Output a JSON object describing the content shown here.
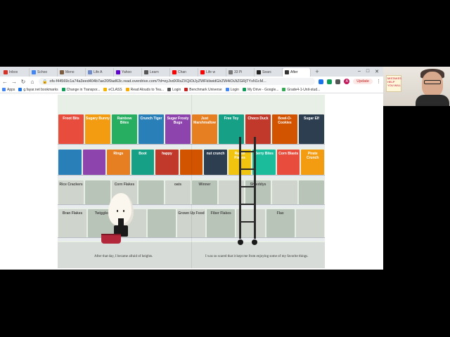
{
  "browser": {
    "tabs": [
      {
        "label": "Inbox",
        "color": "#d93025"
      },
      {
        "label": "Schoo",
        "color": "#4285f4"
      },
      {
        "label": "Meno",
        "color": "#7b5c3e"
      },
      {
        "label": "Life A",
        "color": "#6f8cc8"
      },
      {
        "label": "Yahoo",
        "color": "#6001d2"
      },
      {
        "label": "Learn",
        "color": "#555555"
      },
      {
        "label": "Chan",
        "color": "#ff0000"
      },
      {
        "label": "Life w",
        "color": "#ff0000"
      },
      {
        "label": "33 Pi",
        "color": "#777777"
      },
      {
        "label": "Searc",
        "color": "#222222"
      },
      {
        "label": "After",
        "color": "#333333",
        "active": true
      }
    ],
    "newtab": "+",
    "url": "ofs-f44569c1a74a3eed404b7ae20f9ad63c.read.overdrive.com/?d=eyJvdXRsZXQiOiJyZWFkIiwidGlrZW4iOiJtZGRjTYxN1cM...",
    "update_label": "Update",
    "profile_initial": "A",
    "bookmarks": [
      {
        "label": "Apps",
        "color": "#4285f4"
      },
      {
        "label": "g.fayar.net bookmarks",
        "color": "#1a73e8"
      },
      {
        "label": "Change in Transpor...",
        "color": "#0f9d58"
      },
      {
        "label": "eCLASS",
        "color": "#f4b400"
      },
      {
        "label": "Read Alouds to Tea...",
        "color": "#f9ab00"
      },
      {
        "label": "Login",
        "color": "#555555"
      },
      {
        "label": "Benchmark Universe",
        "color": "#c5221f"
      },
      {
        "label": "Login",
        "color": "#4285f4"
      },
      {
        "label": "My Drive - Google...",
        "color": "#0f9d58"
      },
      {
        "label": "Grade4-1-Unit-stud...",
        "color": "#34a853"
      }
    ]
  },
  "book": {
    "caption_left": "After that day, I became afraid of heights.",
    "caption_right": "I was so scared that it kept me from enjoying some of my favorite things.",
    "boxes_row1": [
      "Froot Bits",
      "Sugary Bunny",
      "Rainbow Bites",
      "Crunch Tiger",
      "Sugar Frosty Bugs",
      "Just Marshmallow",
      "Free Toy",
      "Choco Duck",
      "Bowl-O-Cookies",
      "Sugar Elf"
    ],
    "boxes_row2": [
      "",
      "",
      "Rings",
      "Boot",
      "happy",
      "",
      "nut crunch",
      "Raisin Flakes",
      "Berry Bites",
      "Corn Blasts",
      "Pirate Crunch"
    ],
    "boxes_row3": [
      "Rice Crackers",
      "",
      "Corn Flakes",
      "",
      "oats",
      "Winner",
      "",
      "Shreddys",
      "",
      ""
    ],
    "boxes_row4": [
      "Bran Flakes",
      "Twiggles",
      "",
      "",
      "Grown Up Food",
      "Fiber Flakes",
      "",
      "Flax",
      ""
    ]
  },
  "webcam": {
    "sign_text": "MISTAKES HELP YOU WILL"
  },
  "colors": {
    "shelf": "#e9ecef",
    "price_tag": "#f2c21a",
    "chrome_tabstrip": "#dee1e6"
  }
}
